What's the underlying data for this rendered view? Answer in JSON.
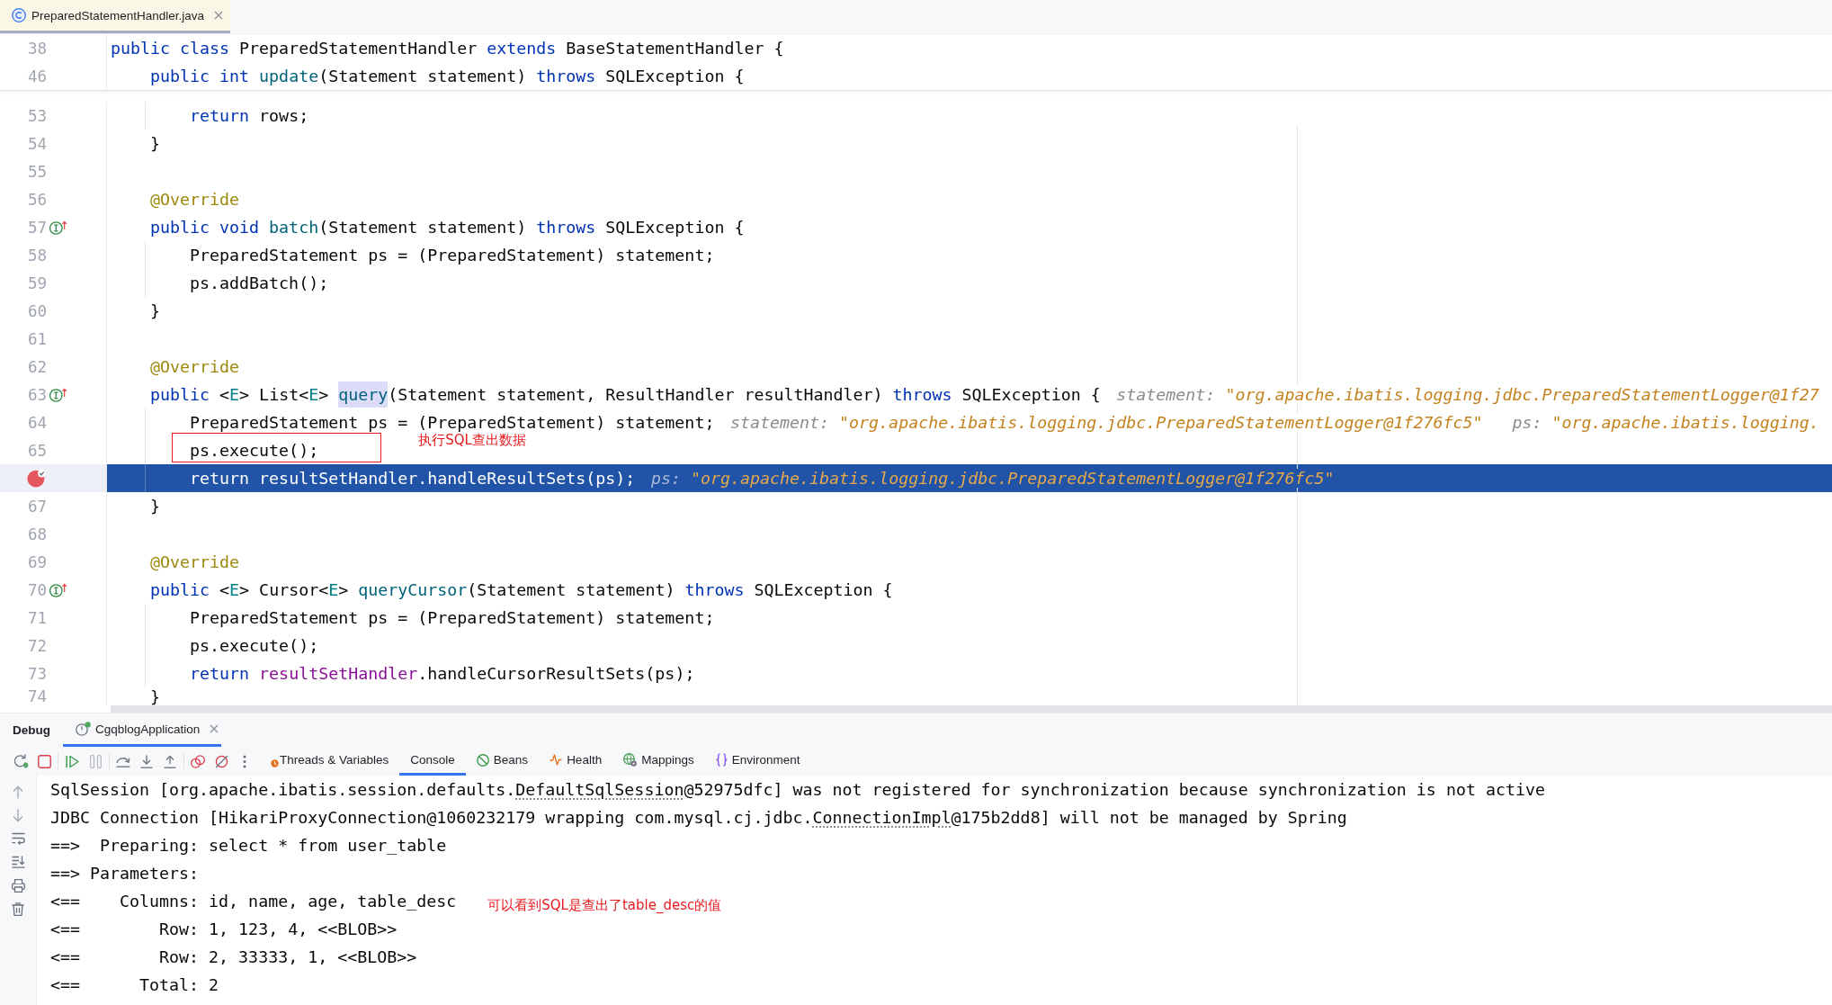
{
  "editor_tabs": [
    {
      "label": "PreparedStatementHandler.java",
      "selected": true
    }
  ],
  "sticky_lines": [
    {
      "number": "38",
      "current": false,
      "segments": [
        {
          "kind": "keyword",
          "text": "public class "
        },
        {
          "kind": "plain",
          "text": "PreparedStatementHandler "
        },
        {
          "kind": "keyword",
          "text": "extends "
        },
        {
          "kind": "plain",
          "text": "BaseStatementHandler {"
        }
      ]
    },
    {
      "number": "46",
      "current": false,
      "segments": [
        {
          "kind": "keyword",
          "text": "    public int "
        },
        {
          "kind": "method",
          "text": "update"
        },
        {
          "kind": "plain",
          "text": "(Statement statement) "
        },
        {
          "kind": "keyword",
          "text": "throws "
        },
        {
          "kind": "plain",
          "text": "SQLException {"
        }
      ]
    }
  ],
  "code_lines": [
    {
      "number": "53",
      "kind": "plain",
      "current": false,
      "segments": [
        {
          "kind": "keyword",
          "text": "        return "
        },
        {
          "kind": "plain",
          "text": "rows;"
        }
      ]
    },
    {
      "number": "54",
      "kind": "plain",
      "current": false,
      "segments": [
        {
          "kind": "plain",
          "text": "    }"
        }
      ]
    },
    {
      "number": "55",
      "kind": "plain",
      "current": false
    },
    {
      "number": "56",
      "kind": "plain",
      "current": false,
      "segments": [
        {
          "kind": "annotation",
          "text": "    @Override"
        }
      ]
    },
    {
      "number": "57",
      "kind": "implements",
      "current": false,
      "segments": [
        {
          "kind": "keyword",
          "text": "    public void "
        },
        {
          "kind": "method",
          "text": "batch"
        },
        {
          "kind": "plain",
          "text": "(Statement statement) "
        },
        {
          "kind": "keyword",
          "text": "throws "
        },
        {
          "kind": "plain",
          "text": "SQLException {"
        }
      ]
    },
    {
      "number": "58",
      "kind": "plain",
      "current": false,
      "segments": [
        {
          "kind": "plain",
          "text": "        PreparedStatement ps = (PreparedStatement) statement;"
        }
      ]
    },
    {
      "number": "59",
      "kind": "plain",
      "current": false,
      "segments": [
        {
          "kind": "plain",
          "text": "        ps.addBatch();"
        }
      ]
    },
    {
      "number": "60",
      "kind": "plain",
      "current": false,
      "segments": [
        {
          "kind": "plain",
          "text": "    }"
        }
      ]
    },
    {
      "number": "61",
      "kind": "plain",
      "current": false
    },
    {
      "number": "62",
      "kind": "plain",
      "current": false,
      "segments": [
        {
          "kind": "annotation",
          "text": "    @Override"
        }
      ]
    },
    {
      "number": "63",
      "kind": "implements",
      "current": false,
      "segments": [
        {
          "kind": "keyword",
          "text": "    public "
        },
        {
          "kind": "plain",
          "text": "<"
        },
        {
          "kind": "type_param",
          "text": "E"
        },
        {
          "kind": "plain",
          "text": "> List<"
        },
        {
          "kind": "type_param",
          "text": "E"
        },
        {
          "kind": "plain",
          "text": "> "
        },
        {
          "kind": "method_usage",
          "text": "query"
        },
        {
          "kind": "plain",
          "text": "(Statement statement, ResultHandler resultHandler) "
        },
        {
          "kind": "keyword",
          "text": "throws "
        },
        {
          "kind": "plain",
          "text": "SQLException {"
        }
      ],
      "hints": [
        {
          "name": "statement:",
          "value": "\"org.apache.ibatis.logging.jdbc.PreparedStatementLogger@1f27"
        }
      ]
    },
    {
      "number": "64",
      "kind": "plain",
      "current": false,
      "segments": [
        {
          "kind": "plain",
          "text": "        PreparedStatement ps = (PreparedStatement) statement;"
        }
      ],
      "hints": [
        {
          "name": "statement:",
          "value": "\"org.apache.ibatis.logging.jdbc.PreparedStatementLogger@1f276fc5\""
        },
        {
          "name": "ps:",
          "value": "\"org.apache.ibatis.logging."
        }
      ]
    },
    {
      "number": "65",
      "kind": "plain",
      "current": false,
      "segments": [
        {
          "kind": "plain",
          "text": "        ps.execute();"
        }
      ],
      "annotation": {
        "boxed": true,
        "note": "执行SQL查出数据"
      }
    },
    {
      "kind": "breakpoint",
      "current": true,
      "segments": [
        {
          "kind": "keyword",
          "text": "        return "
        },
        {
          "kind": "field",
          "text": "resultSetHandler"
        },
        {
          "kind": "plain",
          "text": ".handleResultSets(ps);"
        }
      ],
      "hints": [
        {
          "name": "ps:",
          "value": "\"org.apache.ibatis.logging.jdbc.PreparedStatementLogger@1f276fc5\""
        }
      ]
    },
    {
      "number": "67",
      "kind": "plain",
      "current": false,
      "segments": [
        {
          "kind": "plain",
          "text": "    }"
        }
      ]
    },
    {
      "number": "68",
      "kind": "plain",
      "current": false
    },
    {
      "number": "69",
      "kind": "plain",
      "current": false,
      "segments": [
        {
          "kind": "annotation",
          "text": "    @Override"
        }
      ]
    },
    {
      "number": "70",
      "kind": "implements",
      "current": false,
      "segments": [
        {
          "kind": "keyword",
          "text": "    public "
        },
        {
          "kind": "plain",
          "text": "<"
        },
        {
          "kind": "type_param",
          "text": "E"
        },
        {
          "kind": "plain",
          "text": "> Cursor<"
        },
        {
          "kind": "type_param",
          "text": "E"
        },
        {
          "kind": "plain",
          "text": "> "
        },
        {
          "kind": "method",
          "text": "queryCursor"
        },
        {
          "kind": "plain",
          "text": "(Statement statement) "
        },
        {
          "kind": "keyword",
          "text": "throws "
        },
        {
          "kind": "plain",
          "text": "SQLException {"
        }
      ]
    },
    {
      "number": "71",
      "kind": "plain",
      "current": false,
      "segments": [
        {
          "kind": "plain",
          "text": "        PreparedStatement ps = (PreparedStatement) statement;"
        }
      ]
    },
    {
      "number": "72",
      "kind": "plain",
      "current": false,
      "segments": [
        {
          "kind": "plain",
          "text": "        ps.execute();"
        }
      ]
    },
    {
      "number": "73",
      "kind": "plain",
      "current": false,
      "segments": [
        {
          "kind": "keyword",
          "text": "        return "
        },
        {
          "kind": "field",
          "text": "resultSetHandler"
        },
        {
          "kind": "plain",
          "text": ".handleCursorResultSets(ps);"
        }
      ]
    },
    {
      "number": "74",
      "kind": "plain",
      "current": false,
      "segments": [
        {
          "kind": "plain",
          "text": "    }"
        }
      ]
    }
  ],
  "debug": {
    "title": "Debug",
    "sessions": [
      {
        "label": "CgqblogApplication",
        "selected": true
      }
    ],
    "toolbar_groups": [
      [
        {
          "kind": "rerun",
          "disabled": false
        },
        {
          "kind": "stop",
          "disabled": false
        }
      ],
      [
        {
          "kind": "resume",
          "disabled": false
        },
        {
          "kind": "pause",
          "disabled": true
        }
      ],
      [
        {
          "kind": "step_over",
          "disabled": false
        },
        {
          "kind": "step_into",
          "disabled": false
        },
        {
          "kind": "step_out",
          "disabled": false
        }
      ],
      [
        {
          "kind": "breakpoints",
          "disabled": false
        },
        {
          "kind": "mute",
          "disabled": false
        },
        {
          "kind": "more",
          "disabled": false
        }
      ]
    ],
    "tabs": [
      {
        "label": "Threads & Variables",
        "kind": "threads",
        "selected": false
      },
      {
        "label": "Console",
        "kind": "console",
        "selected": true
      },
      {
        "label": "Beans",
        "kind": "beans",
        "selected": false
      },
      {
        "label": "Health",
        "kind": "health",
        "selected": false
      },
      {
        "label": "Mappings",
        "kind": "mappings",
        "selected": false
      },
      {
        "label": "Environment",
        "kind": "environment",
        "selected": false
      }
    ],
    "console": {
      "tools": [
        {
          "kind": "up"
        },
        {
          "kind": "down"
        },
        {
          "kind": "soft_wrap"
        },
        {
          "kind": "scroll_to_end"
        },
        {
          "kind": "print"
        },
        {
          "kind": "clear"
        }
      ],
      "lines": [
        {
          "segments": [
            {
              "kind": "plain",
              "text": "SqlSession [org.apache.ibatis.session.defaults."
            },
            {
              "kind": "link",
              "text": "DefaultSqlSession"
            },
            {
              "kind": "plain",
              "text": "@52975dfc] was not registered for synchronization because synchronization is not active"
            }
          ]
        },
        {
          "segments": [
            {
              "kind": "plain",
              "text": "JDBC Connection [HikariProxyConnection@1060232179 wrapping com.mysql.cj.jdbc."
            },
            {
              "kind": "link",
              "text": "ConnectionImpl"
            },
            {
              "kind": "plain",
              "text": "@175b2dd8] will not be managed by Spring"
            }
          ]
        },
        {
          "segments": [
            {
              "kind": "plain",
              "text": "==>  Preparing: select * from user_table"
            }
          ]
        },
        {
          "segments": [
            {
              "kind": "plain",
              "text": "==> Parameters:"
            }
          ]
        },
        {
          "segments": [
            {
              "kind": "plain",
              "text": "<==    Columns: id, name, age, table_desc"
            }
          ],
          "note": "可以看到SQL是查出了table_desc的值"
        },
        {
          "segments": [
            {
              "kind": "plain",
              "text": "<==        Row: 1, 123, 4, <<BLOB>>"
            }
          ]
        },
        {
          "segments": [
            {
              "kind": "plain",
              "text": "<==        Row: 2, 33333, 1, <<BLOB>>"
            }
          ]
        },
        {
          "segments": [
            {
              "kind": "plain",
              "text": "<==      Total: 2"
            }
          ]
        }
      ]
    }
  }
}
